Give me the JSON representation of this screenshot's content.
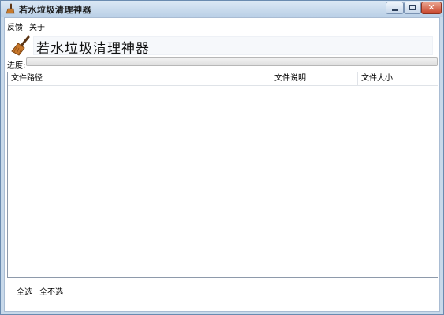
{
  "window": {
    "title": "若水垃圾清理神器"
  },
  "menu": {
    "items": [
      {
        "label": "反馈"
      },
      {
        "label": "关于"
      }
    ]
  },
  "header": {
    "app_name": "若水垃圾清理神器",
    "icon": "broom-icon"
  },
  "progress": {
    "label": "进度:",
    "value_percent": 0,
    "color": "#3bb44a"
  },
  "file_list": {
    "columns": [
      {
        "label": "文件路径"
      },
      {
        "label": "文件说明"
      },
      {
        "label": "文件大小"
      }
    ],
    "rows": []
  },
  "footer": {
    "select_all_label": "全选",
    "select_none_label": "全不选"
  },
  "colors": {
    "titlebar": "#c8d9ea",
    "footer_accent": "#d63a3a"
  }
}
